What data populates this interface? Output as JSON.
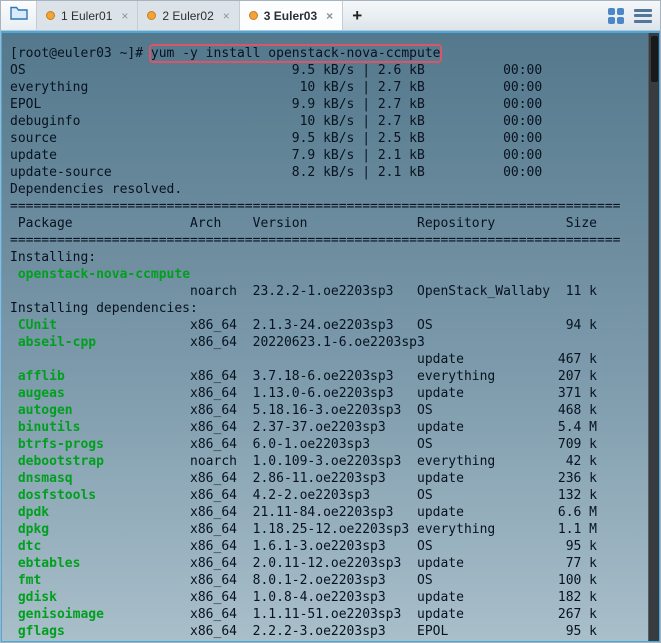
{
  "tab_bar": {
    "tabs": [
      {
        "label": "1 Euler01",
        "active": false
      },
      {
        "label": "2 Euler02",
        "active": false
      },
      {
        "label": "3 Euler03",
        "active": true
      }
    ],
    "close_glyph": "×",
    "new_tab_label": "+"
  },
  "colors": {
    "command_highlight_box": "#d95568",
    "package_name_green": "#00a01e",
    "session_dot_orange": "#f2a33c",
    "terminal_border_blue": "#49a8dd"
  },
  "terminal": {
    "prompt": "[root@euler03 ~]# ",
    "command": "yum -y install openstack-nova-ccmpute",
    "downloads": [
      {
        "repo": "OS",
        "speed": "9.5 kB/s",
        "size": "2.6 kB",
        "time": "00:00"
      },
      {
        "repo": "everything",
        "speed": "10 kB/s",
        "size": "2.7 kB",
        "time": "00:00"
      },
      {
        "repo": "EPOL",
        "speed": "9.9 kB/s",
        "size": "2.7 kB",
        "time": "00:00"
      },
      {
        "repo": "debuginfo",
        "speed": "10 kB/s",
        "size": "2.7 kB",
        "time": "00:00"
      },
      {
        "repo": "source",
        "speed": "9.5 kB/s",
        "size": "2.5 kB",
        "time": "00:00"
      },
      {
        "repo": "update",
        "speed": "7.9 kB/s",
        "size": "2.1 kB",
        "time": "00:00"
      },
      {
        "repo": "update-source",
        "speed": "8.2 kB/s",
        "size": "2.1 kB",
        "time": "00:00"
      }
    ],
    "resolved_message": "Dependencies resolved.",
    "table": {
      "headers": [
        "Package",
        "Arch",
        "Version",
        "Repository",
        "Size"
      ],
      "sections": [
        {
          "title": "Installing:",
          "rows": [
            {
              "name": "openstack-nova-ccmpute",
              "arch": "noarch",
              "version": "23.2.2-1.oe2203sp3",
              "repo": "OpenStack_Wallaby",
              "size": "11 k"
            }
          ]
        },
        {
          "title": "Installing dependencies:",
          "rows": [
            {
              "name": "CUnit",
              "arch": "x86_64",
              "version": "2.1.3-24.oe2203sp3",
              "repo": "OS",
              "size": "94 k"
            },
            {
              "name": "abseil-cpp",
              "arch": "x86_64",
              "version": "20220623.1-6.oe2203sp3",
              "repo": "update",
              "size": "467 k"
            },
            {
              "name": "afflib",
              "arch": "x86_64",
              "version": "3.7.18-6.oe2203sp3",
              "repo": "everything",
              "size": "207 k"
            },
            {
              "name": "augeas",
              "arch": "x86_64",
              "version": "1.13.0-6.oe2203sp3",
              "repo": "update",
              "size": "371 k"
            },
            {
              "name": "autogen",
              "arch": "x86_64",
              "version": "5.18.16-3.oe2203sp3",
              "repo": "OS",
              "size": "468 k"
            },
            {
              "name": "binutils",
              "arch": "x86_64",
              "version": "2.37-37.oe2203sp3",
              "repo": "update",
              "size": "5.4 M"
            },
            {
              "name": "btrfs-progs",
              "arch": "x86_64",
              "version": "6.0-1.oe2203sp3",
              "repo": "OS",
              "size": "709 k"
            },
            {
              "name": "debootstrap",
              "arch": "noarch",
              "version": "1.0.109-3.oe2203sp3",
              "repo": "everything",
              "size": "42 k"
            },
            {
              "name": "dnsmasq",
              "arch": "x86_64",
              "version": "2.86-11.oe2203sp3",
              "repo": "update",
              "size": "236 k"
            },
            {
              "name": "dosfstools",
              "arch": "x86_64",
              "version": "4.2-2.oe2203sp3",
              "repo": "OS",
              "size": "132 k"
            },
            {
              "name": "dpdk",
              "arch": "x86_64",
              "version": "21.11-84.oe2203sp3",
              "repo": "update",
              "size": "6.6 M"
            },
            {
              "name": "dpkg",
              "arch": "x86_64",
              "version": "1.18.25-12.oe2203sp3",
              "repo": "everything",
              "size": "1.1 M"
            },
            {
              "name": "dtc",
              "arch": "x86_64",
              "version": "1.6.1-3.oe2203sp3",
              "repo": "OS",
              "size": "95 k"
            },
            {
              "name": "ebtables",
              "arch": "x86_64",
              "version": "2.0.11-12.oe2203sp3",
              "repo": "update",
              "size": "77 k"
            },
            {
              "name": "fmt",
              "arch": "x86_64",
              "version": "8.0.1-2.oe2203sp3",
              "repo": "OS",
              "size": "100 k"
            },
            {
              "name": "gdisk",
              "arch": "x86_64",
              "version": "1.0.8-4.oe2203sp3",
              "repo": "update",
              "size": "182 k"
            },
            {
              "name": "genisoimage",
              "arch": "x86_64",
              "version": "1.1.11-51.oe2203sp3",
              "repo": "update",
              "size": "267 k"
            },
            {
              "name": "gflags",
              "arch": "x86_64",
              "version": "2.2.2-3.oe2203sp3",
              "repo": "EPOL",
              "size": "95 k"
            }
          ]
        }
      ]
    }
  }
}
